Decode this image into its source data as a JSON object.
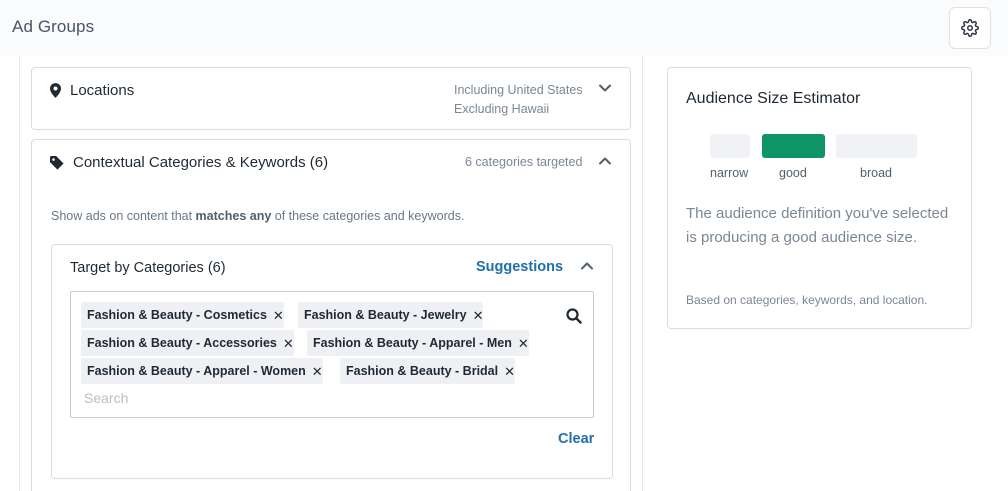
{
  "header": {
    "title": "Ad Groups",
    "settings_icon": "gear-icon"
  },
  "locations": {
    "title": "Locations",
    "including": "Including United States",
    "excluding": "Excluding Hawaii"
  },
  "contextual": {
    "title": "Contextual Categories & Keywords (6)",
    "meta": "6 categories targeted",
    "desc_prefix": "Show ads on content that ",
    "desc_bold": "matches any",
    "desc_suffix": " of these categories and keywords.",
    "target": {
      "title": "Target by Categories (6)",
      "suggestions": "Suggestions",
      "chips": [
        "Fashion & Beauty - Cosmetics",
        "Fashion & Beauty - Jewelry",
        "Fashion & Beauty - Accessories",
        "Fashion & Beauty - Apparel - Men",
        "Fashion & Beauty - Apparel - Women",
        "Fashion & Beauty - Bridal"
      ],
      "chip_remove": "✕",
      "search_placeholder": "Search",
      "clear": "Clear"
    }
  },
  "estimator": {
    "title": "Audience Size Estimator",
    "scale": [
      "narrow",
      "good",
      "broad"
    ],
    "current": "good",
    "colors": {
      "active": "#0e9466",
      "inactive": "#f0f2f5"
    },
    "description": "The audience definition you've selected is producing a good audience size.",
    "footnote": "Based on categories, keywords, and location."
  },
  "colors": {
    "link": "#1f6fa8",
    "text": "#1f2933",
    "muted": "#7b8794"
  }
}
